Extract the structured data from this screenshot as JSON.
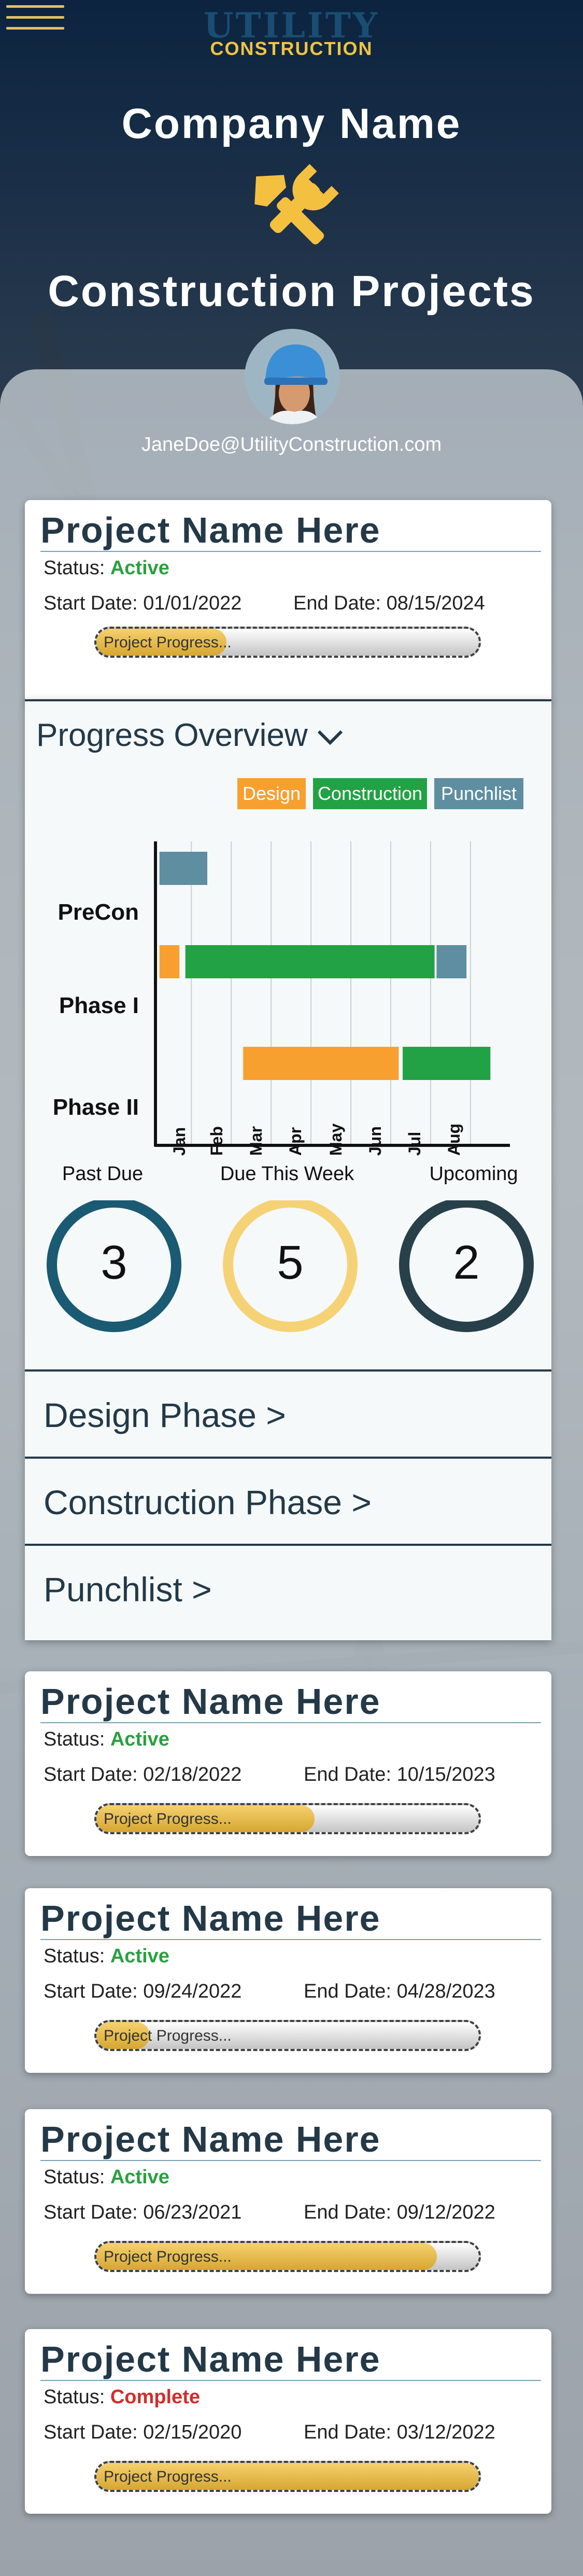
{
  "header": {
    "logo_line1": "UTILITY",
    "logo_line2": "CONSTRUCTION",
    "company_name": "Company Name",
    "page_title": "Construction Projects",
    "user_email": "JaneDoe@UtilityConstruction.com"
  },
  "labels": {
    "status_prefix": "Status: ",
    "start_prefix": "Start Date: ",
    "end_prefix": "End Date: ",
    "progress_text": "Project Progress..."
  },
  "projects": [
    {
      "name": "Project Name Here",
      "status": "Active",
      "start": "01/01/2022",
      "end": "08/15/2024",
      "progress": 0.34
    },
    {
      "name": "Project Name Here",
      "status": "Active",
      "start": "02/18/2022",
      "end": "10/15/2023",
      "progress": 0.57
    },
    {
      "name": "Project Name Here",
      "status": "Active",
      "start": "09/24/2022",
      "end": "04/28/2023",
      "progress": 0.14
    },
    {
      "name": "Project Name Here",
      "status": "Active",
      "start": "06/23/2021",
      "end": "09/12/2022",
      "progress": 0.89
    },
    {
      "name": "Project Name Here",
      "status": "Complete",
      "start": "02/15/2020",
      "end": "03/12/2022",
      "progress": 1.0
    }
  ],
  "overview": {
    "title": "Progress Overview",
    "chevron": "chevron-down-icon",
    "due": [
      {
        "label": "Past Due",
        "count": "3",
        "color": "#1a5a72"
      },
      {
        "label": "Due This Week",
        "count": "5",
        "color": "#f6d277"
      },
      {
        "label": "Upcoming",
        "count": "2",
        "color": "#28404a"
      }
    ],
    "sections": [
      "Design Phase >",
      "Construction Phase >",
      "Punchlist >"
    ]
  },
  "chart_data": {
    "type": "bar",
    "orientation": "horizontal-gantt",
    "categories": [
      "PreCon",
      "Phase I",
      "Phase II"
    ],
    "x_ticks": [
      "Jan",
      "Feb",
      "Mar",
      "Apr",
      "May",
      "Jun",
      "Jul",
      "Aug"
    ],
    "xlim": [
      0,
      8.5
    ],
    "grid": true,
    "legend_placement": "top-right",
    "series": [
      {
        "name": "Design",
        "color": "#f7a030",
        "bars": [
          {
            "category": "Phase I",
            "start": 0.1,
            "end": 0.6
          },
          {
            "category": "Phase II",
            "start": 2.2,
            "end": 6.1
          }
        ]
      },
      {
        "name": "Construction",
        "color": "#22a244",
        "bars": [
          {
            "category": "Phase I",
            "start": 0.75,
            "end": 7.0
          },
          {
            "category": "Phase II",
            "start": 6.2,
            "end": 8.4
          }
        ]
      },
      {
        "name": "Punchlist",
        "color": "#5e8ea0",
        "bars": [
          {
            "category": "PreCon",
            "start": 0.1,
            "end": 1.3
          },
          {
            "category": "Phase I",
            "start": 7.05,
            "end": 7.8
          }
        ]
      }
    ]
  }
}
